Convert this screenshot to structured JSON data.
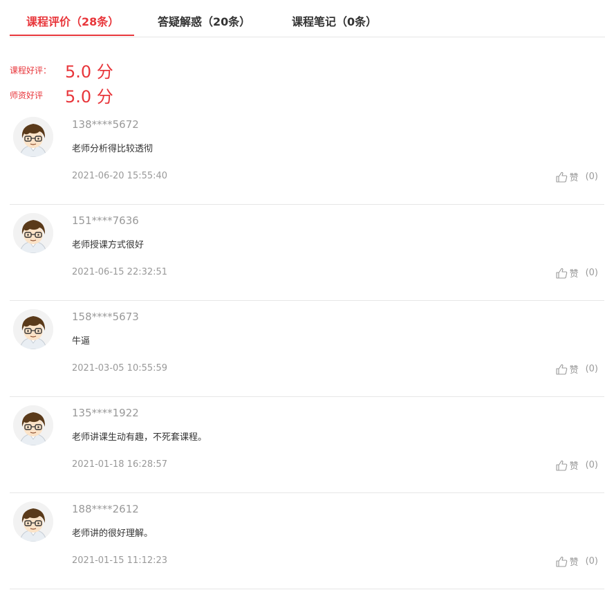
{
  "tabs": [
    {
      "label": "课程评价（28条）",
      "active": true
    },
    {
      "label": "答疑解惑（20条）",
      "active": false
    },
    {
      "label": "课程笔记（0条）",
      "active": false
    }
  ],
  "ratings": [
    {
      "label": "课程好评：",
      "value": "5.0 分"
    },
    {
      "label": "师资好评",
      "value": "5.0 分"
    }
  ],
  "reviews": [
    {
      "user": "138****5672",
      "content": "老师分析得比较透彻",
      "time": "2021-06-20 15:55:40",
      "like_label": "赞",
      "like_count": "(0)"
    },
    {
      "user": "151****7636",
      "content": "老师授课方式很好",
      "time": "2021-06-15 22:32:51",
      "like_label": "赞",
      "like_count": "(0)"
    },
    {
      "user": "158****5673",
      "content": "牛逼",
      "time": "2021-03-05 10:55:59",
      "like_label": "赞",
      "like_count": "(0)"
    },
    {
      "user": "135****1922",
      "content": "老师讲课生动有趣，不死套课程。",
      "time": "2021-01-18 16:28:57",
      "like_label": "赞",
      "like_count": "(0)"
    },
    {
      "user": "188****2612",
      "content": "老师讲的很好理解。",
      "time": "2021-01-15 11:12:23",
      "like_label": "赞",
      "like_count": "(0)"
    }
  ],
  "colors": {
    "accent": "#e8363b",
    "muted": "#999999",
    "divider": "#e6e6e6"
  },
  "icons": {
    "avatar": "cartoon-avatar-icon",
    "like": "thumbs-up-icon"
  }
}
